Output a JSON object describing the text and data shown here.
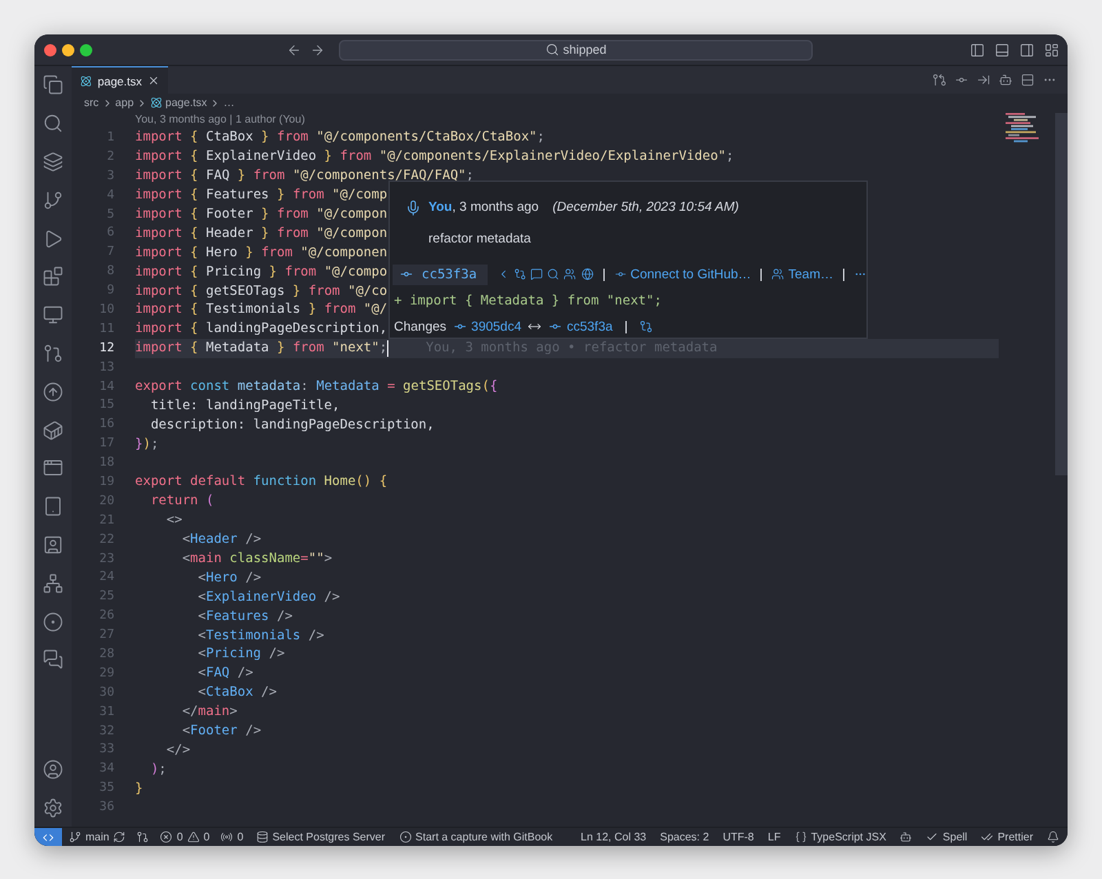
{
  "title_bar": {
    "search": "shipped"
  },
  "tabs": [
    {
      "label": "page.tsx",
      "selected": true
    }
  ],
  "breadcrumbs": [
    "src",
    "app",
    "page.tsx",
    "…"
  ],
  "codelens": "You, 3 months ago | 1 author (You)",
  "lines": [
    {
      "n": "1",
      "cursor": false,
      "tokens": [
        {
          "text": "import ",
          "kind": "kw"
        },
        {
          "text": "{",
          "kind": "brace"
        },
        {
          "text": " CtaBox ",
          "kind": "id"
        },
        {
          "text": "}",
          "kind": "brace"
        },
        {
          "text": " from ",
          "kind": "kw"
        },
        {
          "text": "\"@/components/CtaBox/CtaBox\"",
          "kind": "str"
        },
        {
          "text": ";",
          "kind": "punct"
        }
      ]
    },
    {
      "n": "2",
      "cursor": false,
      "tokens": [
        {
          "text": "import ",
          "kind": "kw"
        },
        {
          "text": "{",
          "kind": "brace"
        },
        {
          "text": " ExplainerVideo ",
          "kind": "id"
        },
        {
          "text": "}",
          "kind": "brace"
        },
        {
          "text": " from ",
          "kind": "kw"
        },
        {
          "text": "\"@/components/ExplainerVideo/ExplainerVideo\"",
          "kind": "str"
        },
        {
          "text": ";",
          "kind": "punct"
        }
      ]
    },
    {
      "n": "3",
      "cursor": false,
      "tokens": [
        {
          "text": "import ",
          "kind": "kw"
        },
        {
          "text": "{",
          "kind": "brace"
        },
        {
          "text": " FAQ ",
          "kind": "id"
        },
        {
          "text": "}",
          "kind": "brace"
        },
        {
          "text": " from ",
          "kind": "kw"
        },
        {
          "text": "\"@/components/FAQ/FAQ\"",
          "kind": "str"
        },
        {
          "text": ";",
          "kind": "punct"
        }
      ]
    },
    {
      "n": "4",
      "cursor": false,
      "tokens": [
        {
          "text": "import ",
          "kind": "kw"
        },
        {
          "text": "{",
          "kind": "brace"
        },
        {
          "text": " Features ",
          "kind": "id"
        },
        {
          "text": "}",
          "kind": "brace"
        },
        {
          "text": " from ",
          "kind": "kw"
        },
        {
          "text": "\"@/comp",
          "kind": "str"
        }
      ]
    },
    {
      "n": "5",
      "cursor": false,
      "tokens": [
        {
          "text": "import ",
          "kind": "kw"
        },
        {
          "text": "{",
          "kind": "brace"
        },
        {
          "text": " Footer ",
          "kind": "id"
        },
        {
          "text": "}",
          "kind": "brace"
        },
        {
          "text": " from ",
          "kind": "kw"
        },
        {
          "text": "\"@/compon",
          "kind": "str"
        }
      ]
    },
    {
      "n": "6",
      "cursor": false,
      "tokens": [
        {
          "text": "import ",
          "kind": "kw"
        },
        {
          "text": "{",
          "kind": "brace"
        },
        {
          "text": " Header ",
          "kind": "id"
        },
        {
          "text": "}",
          "kind": "brace"
        },
        {
          "text": " from ",
          "kind": "kw"
        },
        {
          "text": "\"@/compon",
          "kind": "str"
        }
      ]
    },
    {
      "n": "7",
      "cursor": false,
      "tokens": [
        {
          "text": "import ",
          "kind": "kw"
        },
        {
          "text": "{",
          "kind": "brace"
        },
        {
          "text": " Hero ",
          "kind": "id"
        },
        {
          "text": "}",
          "kind": "brace"
        },
        {
          "text": " from ",
          "kind": "kw"
        },
        {
          "text": "\"@/componen",
          "kind": "str"
        }
      ]
    },
    {
      "n": "8",
      "cursor": false,
      "tokens": [
        {
          "text": "import ",
          "kind": "kw"
        },
        {
          "text": "{",
          "kind": "brace"
        },
        {
          "text": " Pricing ",
          "kind": "id"
        },
        {
          "text": "}",
          "kind": "brace"
        },
        {
          "text": " from ",
          "kind": "kw"
        },
        {
          "text": "\"@/compo",
          "kind": "str"
        }
      ]
    },
    {
      "n": "9",
      "cursor": false,
      "tokens": [
        {
          "text": "import ",
          "kind": "kw"
        },
        {
          "text": "{",
          "kind": "brace"
        },
        {
          "text": " getSEOTags ",
          "kind": "id"
        },
        {
          "text": "}",
          "kind": "brace"
        },
        {
          "text": " from ",
          "kind": "kw"
        },
        {
          "text": "\"@/co",
          "kind": "str"
        }
      ]
    },
    {
      "n": "10",
      "cursor": false,
      "tokens": [
        {
          "text": "import ",
          "kind": "kw"
        },
        {
          "text": "{",
          "kind": "brace"
        },
        {
          "text": " Testimonials ",
          "kind": "id"
        },
        {
          "text": "}",
          "kind": "brace"
        },
        {
          "text": " from ",
          "kind": "kw"
        },
        {
          "text": "\"@/",
          "kind": "str"
        }
      ]
    },
    {
      "n": "11",
      "cursor": false,
      "tokens": [
        {
          "text": "import ",
          "kind": "kw"
        },
        {
          "text": "{",
          "kind": "brace"
        },
        {
          "text": " landingPageDescription,",
          "kind": "id"
        }
      ]
    },
    {
      "n": "12",
      "cursor": true,
      "blame": "You, 3 months ago • refactor metadata",
      "tokens": [
        {
          "text": "import ",
          "kind": "kw"
        },
        {
          "text": "{",
          "kind": "brace"
        },
        {
          "text": " Metadata ",
          "kind": "id"
        },
        {
          "text": "}",
          "kind": "brace"
        },
        {
          "text": " from ",
          "kind": "kw"
        },
        {
          "text": "\"next\"",
          "kind": "str"
        },
        {
          "text": ";",
          "kind": "punct"
        }
      ]
    },
    {
      "n": "13",
      "cursor": false
    },
    {
      "n": "14",
      "cursor": false,
      "tokens": [
        {
          "text": "export ",
          "kind": "kw"
        },
        {
          "text": "const ",
          "kind": "decl"
        },
        {
          "text": "metadata",
          "kind": "var"
        },
        {
          "text": ": ",
          "kind": "punct"
        },
        {
          "text": "Metadata",
          "kind": "type"
        },
        {
          "text": " = ",
          "kind": "kw"
        },
        {
          "text": "getSEOTags",
          "kind": "fn"
        },
        {
          "text": "(",
          "kind": "brace"
        },
        {
          "text": "{",
          "kind": "paren"
        }
      ]
    },
    {
      "n": "15",
      "cursor": false,
      "tokens": [
        {
          "text": "  title: landingPageTitle,",
          "kind": "id"
        }
      ]
    },
    {
      "n": "16",
      "cursor": false,
      "tokens": [
        {
          "text": "  description: landingPageDescription,",
          "kind": "id"
        }
      ]
    },
    {
      "n": "17",
      "cursor": false,
      "tokens": [
        {
          "text": "}",
          "kind": "paren"
        },
        {
          "text": ")",
          "kind": "brace"
        },
        {
          "text": ";",
          "kind": "punct"
        }
      ]
    },
    {
      "n": "18",
      "cursor": false
    },
    {
      "n": "19",
      "cursor": false,
      "tokens": [
        {
          "text": "export default ",
          "kind": "kw"
        },
        {
          "text": "function ",
          "kind": "decl"
        },
        {
          "text": "Home",
          "kind": "fn"
        },
        {
          "text": "() {",
          "kind": "brace"
        }
      ]
    },
    {
      "n": "20",
      "cursor": false,
      "tokens": [
        {
          "text": "  return ",
          "kind": "kw"
        },
        {
          "text": "(",
          "kind": "paren"
        }
      ]
    },
    {
      "n": "21",
      "cursor": false,
      "tokens": [
        {
          "text": "    <>",
          "kind": "punct"
        }
      ]
    },
    {
      "n": "22",
      "cursor": false,
      "tokens": [
        {
          "text": "      <",
          "kind": "punct"
        },
        {
          "text": "Header",
          "kind": "tag"
        },
        {
          "text": " />",
          "kind": "punct"
        }
      ]
    },
    {
      "n": "23",
      "cursor": false,
      "tokens": [
        {
          "text": "      <",
          "kind": "punct"
        },
        {
          "text": "main ",
          "kind": "kw"
        },
        {
          "text": "className",
          "kind": "attr"
        },
        {
          "text": "=",
          "kind": "kw"
        },
        {
          "text": "\"\"",
          "kind": "str"
        },
        {
          "text": ">",
          "kind": "punct"
        }
      ]
    },
    {
      "n": "24",
      "cursor": false,
      "tokens": [
        {
          "text": "        <",
          "kind": "punct"
        },
        {
          "text": "Hero",
          "kind": "tag"
        },
        {
          "text": " />",
          "kind": "punct"
        }
      ]
    },
    {
      "n": "25",
      "cursor": false,
      "tokens": [
        {
          "text": "        <",
          "kind": "punct"
        },
        {
          "text": "ExplainerVideo",
          "kind": "tag"
        },
        {
          "text": " />",
          "kind": "punct"
        }
      ]
    },
    {
      "n": "26",
      "cursor": false,
      "tokens": [
        {
          "text": "        <",
          "kind": "punct"
        },
        {
          "text": "Features",
          "kind": "tag"
        },
        {
          "text": " />",
          "kind": "punct"
        }
      ]
    },
    {
      "n": "27",
      "cursor": false,
      "tokens": [
        {
          "text": "        <",
          "kind": "punct"
        },
        {
          "text": "Testimonials",
          "kind": "tag"
        },
        {
          "text": " />",
          "kind": "punct"
        }
      ]
    },
    {
      "n": "28",
      "cursor": false,
      "tokens": [
        {
          "text": "        <",
          "kind": "punct"
        },
        {
          "text": "Pricing",
          "kind": "tag"
        },
        {
          "text": " />",
          "kind": "punct"
        }
      ]
    },
    {
      "n": "29",
      "cursor": false,
      "tokens": [
        {
          "text": "        <",
          "kind": "punct"
        },
        {
          "text": "FAQ",
          "kind": "tag"
        },
        {
          "text": " />",
          "kind": "punct"
        }
      ]
    },
    {
      "n": "30",
      "cursor": false,
      "tokens": [
        {
          "text": "        <",
          "kind": "punct"
        },
        {
          "text": "CtaBox",
          "kind": "tag"
        },
        {
          "text": " />",
          "kind": "punct"
        }
      ]
    },
    {
      "n": "31",
      "cursor": false,
      "tokens": [
        {
          "text": "      </",
          "kind": "punct"
        },
        {
          "text": "main",
          "kind": "kw"
        },
        {
          "text": ">",
          "kind": "punct"
        }
      ]
    },
    {
      "n": "32",
      "cursor": false,
      "tokens": [
        {
          "text": "      <",
          "kind": "punct"
        },
        {
          "text": "Footer",
          "kind": "tag"
        },
        {
          "text": " />",
          "kind": "punct"
        }
      ]
    },
    {
      "n": "33",
      "cursor": false,
      "tokens": [
        {
          "text": "    </>",
          "kind": "punct"
        }
      ]
    },
    {
      "n": "34",
      "cursor": false,
      "tokens": [
        {
          "text": "  )",
          "kind": "paren"
        },
        {
          "text": ";",
          "kind": "punct"
        }
      ]
    },
    {
      "n": "35",
      "cursor": false,
      "tokens": [
        {
          "text": "}",
          "kind": "brace"
        }
      ]
    },
    {
      "n": "36",
      "cursor": false
    }
  ],
  "hover": {
    "author": "You",
    "age": ", 3 months ago",
    "date": "(December 5th, 2023 10:54 AM)",
    "message": "refactor metadata",
    "sha": "cc53f3a",
    "links": [
      "Connect to GitHub…",
      "Team…"
    ],
    "diff": "+ import { Metadata } from \"next\";",
    "changes_label": "Changes",
    "from_sha": "3905dc4",
    "to_sha": "cc53f3a"
  },
  "status_bar": {
    "branch": "main",
    "errors": "0",
    "warnings": "0",
    "ports": "0",
    "postgres": "Select Postgres Server",
    "gitbook": "Start a capture with GitBook",
    "position": "Ln 12, Col 33",
    "indentation": "Spaces: 2",
    "encoding": "UTF-8",
    "eol": "LF",
    "language": "TypeScript JSX",
    "spell": "Spell",
    "prettier": "Prettier"
  }
}
